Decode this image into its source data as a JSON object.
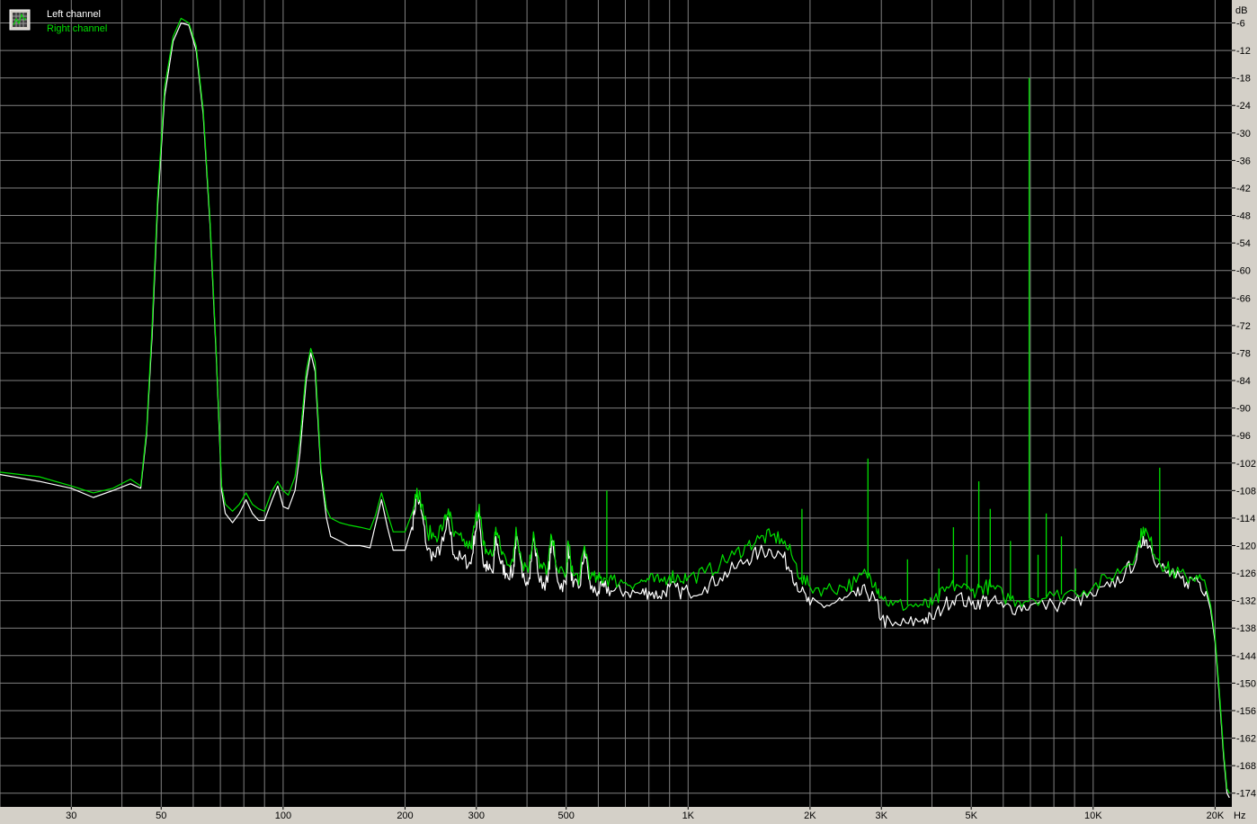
{
  "colors": {
    "background": "#000000",
    "grid": "#808080",
    "axis_panel": "#d4d0c8",
    "left_channel": "#ffffff",
    "right_channel": "#00e000"
  },
  "legend": {
    "icon": "spectrum-grid-icon",
    "left_label": "Left channel",
    "right_label": "Right channel"
  },
  "chart_data": {
    "type": "line",
    "title": "",
    "xlabel": "Hz",
    "ylabel": "dB",
    "x_scale": "log",
    "xlim": [
      20,
      22000
    ],
    "ylim": [
      -177,
      -1
    ],
    "grid": true,
    "legend_position": "top-left",
    "x_tick_labels": [
      {
        "value": 30,
        "label": "30"
      },
      {
        "value": 50,
        "label": "50"
      },
      {
        "value": 100,
        "label": "100"
      },
      {
        "value": 200,
        "label": "200"
      },
      {
        "value": 300,
        "label": "300"
      },
      {
        "value": 500,
        "label": "500"
      },
      {
        "value": 1000,
        "label": "1K"
      },
      {
        "value": 2000,
        "label": "2K"
      },
      {
        "value": 3000,
        "label": "3K"
      },
      {
        "value": 5000,
        "label": "5K"
      },
      {
        "value": 10000,
        "label": "10K"
      },
      {
        "value": 20000,
        "label": "20K"
      }
    ],
    "y_tick_labels": [
      "-6",
      "-12",
      "-18",
      "-24",
      "-30",
      "-36",
      "-42",
      "-48",
      "-54",
      "-60",
      "-66",
      "-72",
      "-78",
      "-84",
      "-90",
      "-96",
      "-102",
      "-108",
      "-114",
      "-120",
      "-126",
      "-132",
      "-138",
      "-144",
      "-150",
      "-156",
      "-162",
      "-168",
      "-174"
    ],
    "series": [
      {
        "name": "Left channel",
        "color": "#ffffff",
        "points": [
          [
            20,
            -104.5
          ],
          [
            25,
            -106
          ],
          [
            30,
            -107.5
          ],
          [
            34,
            -109.5
          ],
          [
            38,
            -108
          ],
          [
            42,
            -106.5
          ],
          [
            44.5,
            -107.5
          ],
          [
            46,
            -96
          ],
          [
            47.5,
            -74
          ],
          [
            49,
            -46
          ],
          [
            51,
            -22
          ],
          [
            53.5,
            -10
          ],
          [
            56,
            -6
          ],
          [
            58.5,
            -6.5
          ],
          [
            61,
            -12
          ],
          [
            63.5,
            -26
          ],
          [
            66,
            -50
          ],
          [
            68.5,
            -80
          ],
          [
            70.5,
            -108
          ],
          [
            72,
            -113
          ],
          [
            75,
            -115
          ],
          [
            78,
            -113
          ],
          [
            81,
            -110
          ],
          [
            84,
            -113
          ],
          [
            87,
            -114.5
          ],
          [
            90,
            -114.5
          ],
          [
            94,
            -110
          ],
          [
            97,
            -107
          ],
          [
            100,
            -111.5
          ],
          [
            103,
            -112
          ],
          [
            107,
            -108
          ],
          [
            110,
            -100
          ],
          [
            114,
            -84
          ],
          [
            117,
            -78
          ],
          [
            120,
            -82
          ],
          [
            124,
            -104
          ],
          [
            128,
            -114
          ],
          [
            131,
            -118
          ],
          [
            138,
            -119
          ],
          [
            145,
            -120
          ],
          [
            155,
            -120
          ],
          [
            164,
            -120.5
          ],
          [
            169,
            -115.5
          ],
          [
            175,
            -110
          ],
          [
            181,
            -116
          ],
          [
            187,
            -121
          ],
          [
            200,
            -121
          ],
          [
            208,
            -116
          ],
          [
            214,
            -109
          ],
          [
            220,
            -113
          ],
          [
            227,
            -121
          ],
          [
            238,
            -122.5
          ],
          [
            249,
            -119
          ],
          [
            256,
            -114.5
          ],
          [
            264,
            -122
          ],
          [
            277,
            -123
          ],
          [
            291,
            -124
          ],
          [
            298,
            -117
          ],
          [
            305,
            -113
          ],
          [
            312,
            -124
          ],
          [
            320,
            -125
          ],
          [
            330,
            -126
          ],
          [
            335,
            -118
          ],
          [
            345,
            -124
          ],
          [
            355,
            -126
          ],
          [
            370,
            -126
          ],
          [
            376,
            -118
          ],
          [
            390,
            -127
          ],
          [
            405,
            -127
          ],
          [
            415,
            -118
          ],
          [
            430,
            -128
          ],
          [
            450,
            -128
          ],
          [
            460,
            -119
          ],
          [
            480,
            -128.5
          ],
          [
            500,
            -128.5
          ],
          [
            505,
            -120
          ],
          [
            520,
            -129
          ],
          [
            540,
            -129
          ],
          [
            555,
            -121
          ],
          [
            575,
            -129.5
          ],
          [
            600,
            -130
          ],
          [
            620,
            -129
          ],
          [
            650,
            -130
          ],
          [
            700,
            -130
          ],
          [
            760,
            -130.5
          ],
          [
            800,
            -130
          ],
          [
            850,
            -131
          ],
          [
            900,
            -129
          ],
          [
            950,
            -130
          ],
          [
            1000,
            -130
          ],
          [
            1100,
            -129
          ],
          [
            1200,
            -127
          ],
          [
            1300,
            -125
          ],
          [
            1400,
            -123
          ],
          [
            1500,
            -121.5
          ],
          [
            1600,
            -121
          ],
          [
            1700,
            -122
          ],
          [
            1800,
            -125.5
          ],
          [
            1900,
            -130
          ],
          [
            2000,
            -133
          ],
          [
            2200,
            -133
          ],
          [
            2400,
            -132
          ],
          [
            2600,
            -131
          ],
          [
            2750,
            -130
          ],
          [
            2900,
            -132
          ],
          [
            3000,
            -136
          ],
          [
            3200,
            -137.5
          ],
          [
            3500,
            -137
          ],
          [
            3800,
            -136
          ],
          [
            4000,
            -136
          ],
          [
            4300,
            -133
          ],
          [
            4600,
            -131
          ],
          [
            5000,
            -133
          ],
          [
            5300,
            -132
          ],
          [
            5600,
            -132
          ],
          [
            6000,
            -133.5
          ],
          [
            6500,
            -133.5
          ],
          [
            7000,
            -133
          ],
          [
            8000,
            -133
          ],
          [
            9000,
            -132
          ],
          [
            10000,
            -131
          ],
          [
            11000,
            -129
          ],
          [
            12000,
            -126
          ],
          [
            12800,
            -123
          ],
          [
            13300,
            -118
          ],
          [
            13800,
            -120
          ],
          [
            14500,
            -124
          ],
          [
            15200,
            -126
          ],
          [
            16000,
            -127
          ],
          [
            17000,
            -128
          ],
          [
            18000,
            -127
          ],
          [
            19000,
            -130
          ],
          [
            19500,
            -134
          ],
          [
            20000,
            -141
          ],
          [
            20500,
            -153
          ],
          [
            21000,
            -166
          ],
          [
            21400,
            -174
          ],
          [
            21700,
            -175
          ]
        ]
      },
      {
        "name": "Right channel",
        "color": "#00e000",
        "points": [
          [
            20,
            -104
          ],
          [
            25,
            -105
          ],
          [
            30,
            -107
          ],
          [
            34,
            -108.5
          ],
          [
            38,
            -107.5
          ],
          [
            42,
            -105.5
          ],
          [
            44.5,
            -107
          ],
          [
            46,
            -95
          ],
          [
            47.5,
            -72
          ],
          [
            49,
            -44
          ],
          [
            51,
            -20
          ],
          [
            53.5,
            -9
          ],
          [
            56,
            -5
          ],
          [
            58.5,
            -6
          ],
          [
            61,
            -11
          ],
          [
            63.5,
            -25
          ],
          [
            66,
            -49
          ],
          [
            68.5,
            -79
          ],
          [
            70.5,
            -107
          ],
          [
            72,
            -111
          ],
          [
            75,
            -112.5
          ],
          [
            78,
            -111
          ],
          [
            81,
            -108.5
          ],
          [
            84,
            -111
          ],
          [
            87,
            -112
          ],
          [
            90,
            -112.5
          ],
          [
            94,
            -108
          ],
          [
            97,
            -106
          ],
          [
            100,
            -108
          ],
          [
            103,
            -109
          ],
          [
            107,
            -105
          ],
          [
            110,
            -97
          ],
          [
            114,
            -82
          ],
          [
            117,
            -77
          ],
          [
            120,
            -80
          ],
          [
            124,
            -103
          ],
          [
            128,
            -112
          ],
          [
            131,
            -114
          ],
          [
            138,
            -115
          ],
          [
            145,
            -115.5
          ],
          [
            155,
            -116
          ],
          [
            164,
            -116.5
          ],
          [
            169,
            -113.5
          ],
          [
            175,
            -108.5
          ],
          [
            181,
            -113
          ],
          [
            187,
            -117
          ],
          [
            200,
            -117
          ],
          [
            208,
            -113
          ],
          [
            214,
            -107.5
          ],
          [
            220,
            -111
          ],
          [
            227,
            -117
          ],
          [
            238,
            -118
          ],
          [
            249,
            -115.5
          ],
          [
            256,
            -112
          ],
          [
            264,
            -118
          ],
          [
            277,
            -119
          ],
          [
            291,
            -120.5
          ],
          [
            298,
            -115
          ],
          [
            305,
            -111
          ],
          [
            312,
            -120
          ],
          [
            320,
            -121.5
          ],
          [
            330,
            -122
          ],
          [
            335,
            -116
          ],
          [
            345,
            -121
          ],
          [
            355,
            -123
          ],
          [
            370,
            -123.5
          ],
          [
            376,
            -116
          ],
          [
            390,
            -124
          ],
          [
            405,
            -124.5
          ],
          [
            415,
            -117
          ],
          [
            430,
            -125
          ],
          [
            450,
            -125
          ],
          [
            460,
            -118
          ],
          [
            480,
            -126
          ],
          [
            500,
            -126
          ],
          [
            505,
            -119
          ],
          [
            520,
            -126.5
          ],
          [
            540,
            -127
          ],
          [
            555,
            -120
          ],
          [
            575,
            -127
          ],
          [
            600,
            -127.5
          ],
          [
            620,
            -127
          ],
          [
            650,
            -127.5
          ],
          [
            700,
            -128
          ],
          [
            760,
            -128
          ],
          [
            800,
            -127.5
          ],
          [
            850,
            -128
          ],
          [
            900,
            -126.5
          ],
          [
            950,
            -127
          ],
          [
            1000,
            -127
          ],
          [
            1100,
            -126
          ],
          [
            1200,
            -124
          ],
          [
            1300,
            -122
          ],
          [
            1400,
            -120
          ],
          [
            1500,
            -118.5
          ],
          [
            1600,
            -118
          ],
          [
            1700,
            -118.5
          ],
          [
            1800,
            -122
          ],
          [
            1900,
            -127
          ],
          [
            2000,
            -129
          ],
          [
            2200,
            -129.5
          ],
          [
            2400,
            -129
          ],
          [
            2600,
            -128
          ],
          [
            2750,
            -126
          ],
          [
            2900,
            -128
          ],
          [
            3000,
            -131
          ],
          [
            3200,
            -133
          ],
          [
            3500,
            -133
          ],
          [
            3800,
            -133
          ],
          [
            4000,
            -133
          ],
          [
            4300,
            -130
          ],
          [
            4600,
            -128.5
          ],
          [
            5000,
            -130
          ],
          [
            5300,
            -129
          ],
          [
            5600,
            -129
          ],
          [
            6000,
            -131
          ],
          [
            6500,
            -132
          ],
          [
            7000,
            -131.5
          ],
          [
            8000,
            -131
          ],
          [
            9000,
            -130
          ],
          [
            10000,
            -129
          ],
          [
            11000,
            -127
          ],
          [
            12000,
            -124.5
          ],
          [
            12800,
            -121.5
          ],
          [
            13300,
            -116
          ],
          [
            13800,
            -119
          ],
          [
            14500,
            -123
          ],
          [
            15200,
            -125
          ],
          [
            16000,
            -126
          ],
          [
            17000,
            -127
          ],
          [
            18000,
            -126.5
          ],
          [
            19000,
            -129
          ],
          [
            19500,
            -133
          ],
          [
            20000,
            -140
          ],
          [
            20500,
            -152
          ],
          [
            21000,
            -165
          ],
          [
            21400,
            -173
          ],
          [
            21700,
            -174
          ]
        ]
      }
    ],
    "annotations": [
      {
        "series": "Right channel",
        "x": 630,
        "y": -108
      },
      {
        "series": "Right channel",
        "x": 1910,
        "y": -112
      },
      {
        "series": "Right channel",
        "x": 2780,
        "y": -101
      },
      {
        "series": "Right channel",
        "x": 3480,
        "y": -123
      },
      {
        "series": "Right channel",
        "x": 4160,
        "y": -125
      },
      {
        "series": "Right channel",
        "x": 4520,
        "y": -116
      },
      {
        "series": "Right channel",
        "x": 4880,
        "y": -122
      },
      {
        "series": "Right channel",
        "x": 5220,
        "y": -106
      },
      {
        "series": "Right channel",
        "x": 5570,
        "y": -112
      },
      {
        "series": "Right channel",
        "x": 6250,
        "y": -119
      },
      {
        "series": "Right channel",
        "x": 6950,
        "y": -18
      },
      {
        "series": "Right channel",
        "x": 7310,
        "y": -122
      },
      {
        "series": "Right channel",
        "x": 7660,
        "y": -113
      },
      {
        "series": "Right channel",
        "x": 8350,
        "y": -118
      },
      {
        "series": "Right channel",
        "x": 9050,
        "y": -125
      },
      {
        "series": "Right channel",
        "x": 14600,
        "y": -103
      }
    ]
  }
}
